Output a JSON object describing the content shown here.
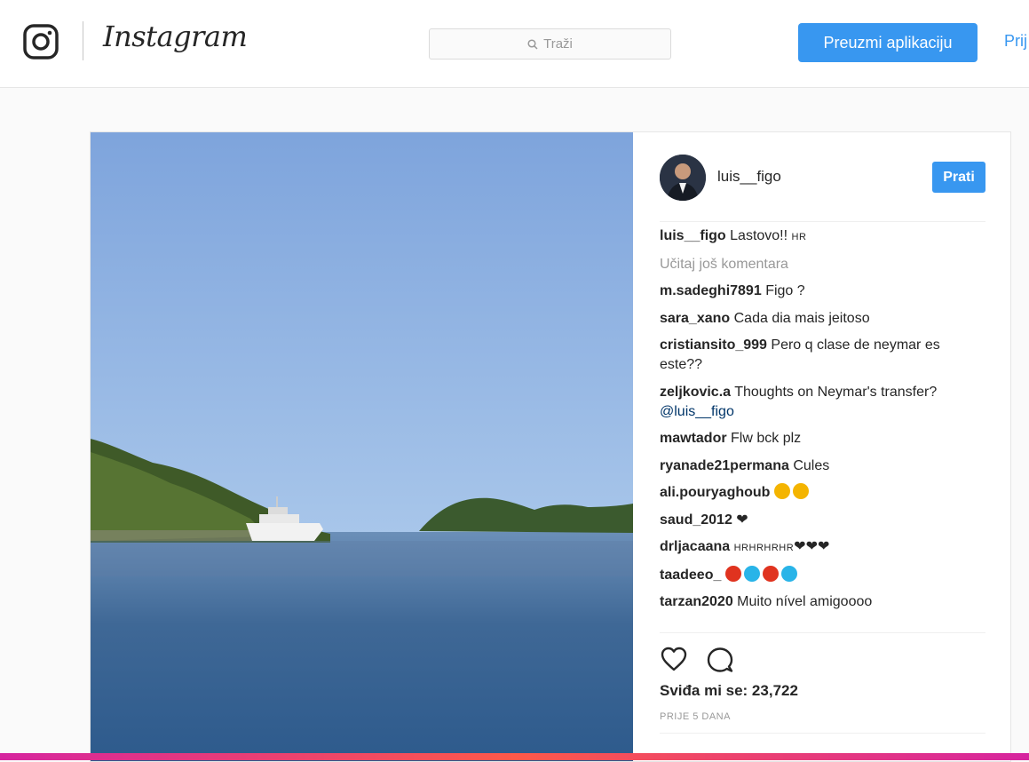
{
  "header": {
    "brand": "Instagram",
    "search_placeholder": "Traži",
    "get_app_label": "Preuzmi aplikaciju",
    "login_label": "Prij"
  },
  "post": {
    "author": "luis__figo",
    "follow_label": "Prati",
    "caption": {
      "user": "luis__figo",
      "text": "Lastovo!!",
      "flag": "HR"
    },
    "load_more_label": "Učitaj još komentara",
    "comments": [
      {
        "user": "m.sadeghi7891",
        "text": "Figo ?"
      },
      {
        "user": "sara_xano",
        "text": "Cada dia mais jeitoso"
      },
      {
        "user": "cristiansito_999",
        "text": "Pero q clase de neymar es este??"
      },
      {
        "user": "zeljkovic.a",
        "text": "Thoughts on Neymar's transfer?",
        "mention": "@luis__figo"
      },
      {
        "user": "mawtador",
        "text": "Flw bck plz"
      },
      {
        "user": "ryanade21permana",
        "text": "Cules"
      },
      {
        "user": "ali.pouryaghoub",
        "text": ""
      },
      {
        "user": "saud_2012",
        "text": "❤"
      },
      {
        "user": "drljacaana",
        "text": "HRHRHRHR",
        "hearts": "❤❤❤"
      },
      {
        "user": "taadeeo_",
        "text": ""
      },
      {
        "user": "tarzan2020",
        "text": "Muito nível amigoooo"
      }
    ],
    "likes_label": "Sviđa mi se: 23,722",
    "time_label": "PRIJE 5 DANA"
  },
  "colors": {
    "accent": "#3897f0",
    "text": "#262626",
    "muted": "#999999"
  },
  "icons": [
    "instagram-camera-icon",
    "search-icon",
    "heart-icon",
    "comment-icon"
  ]
}
